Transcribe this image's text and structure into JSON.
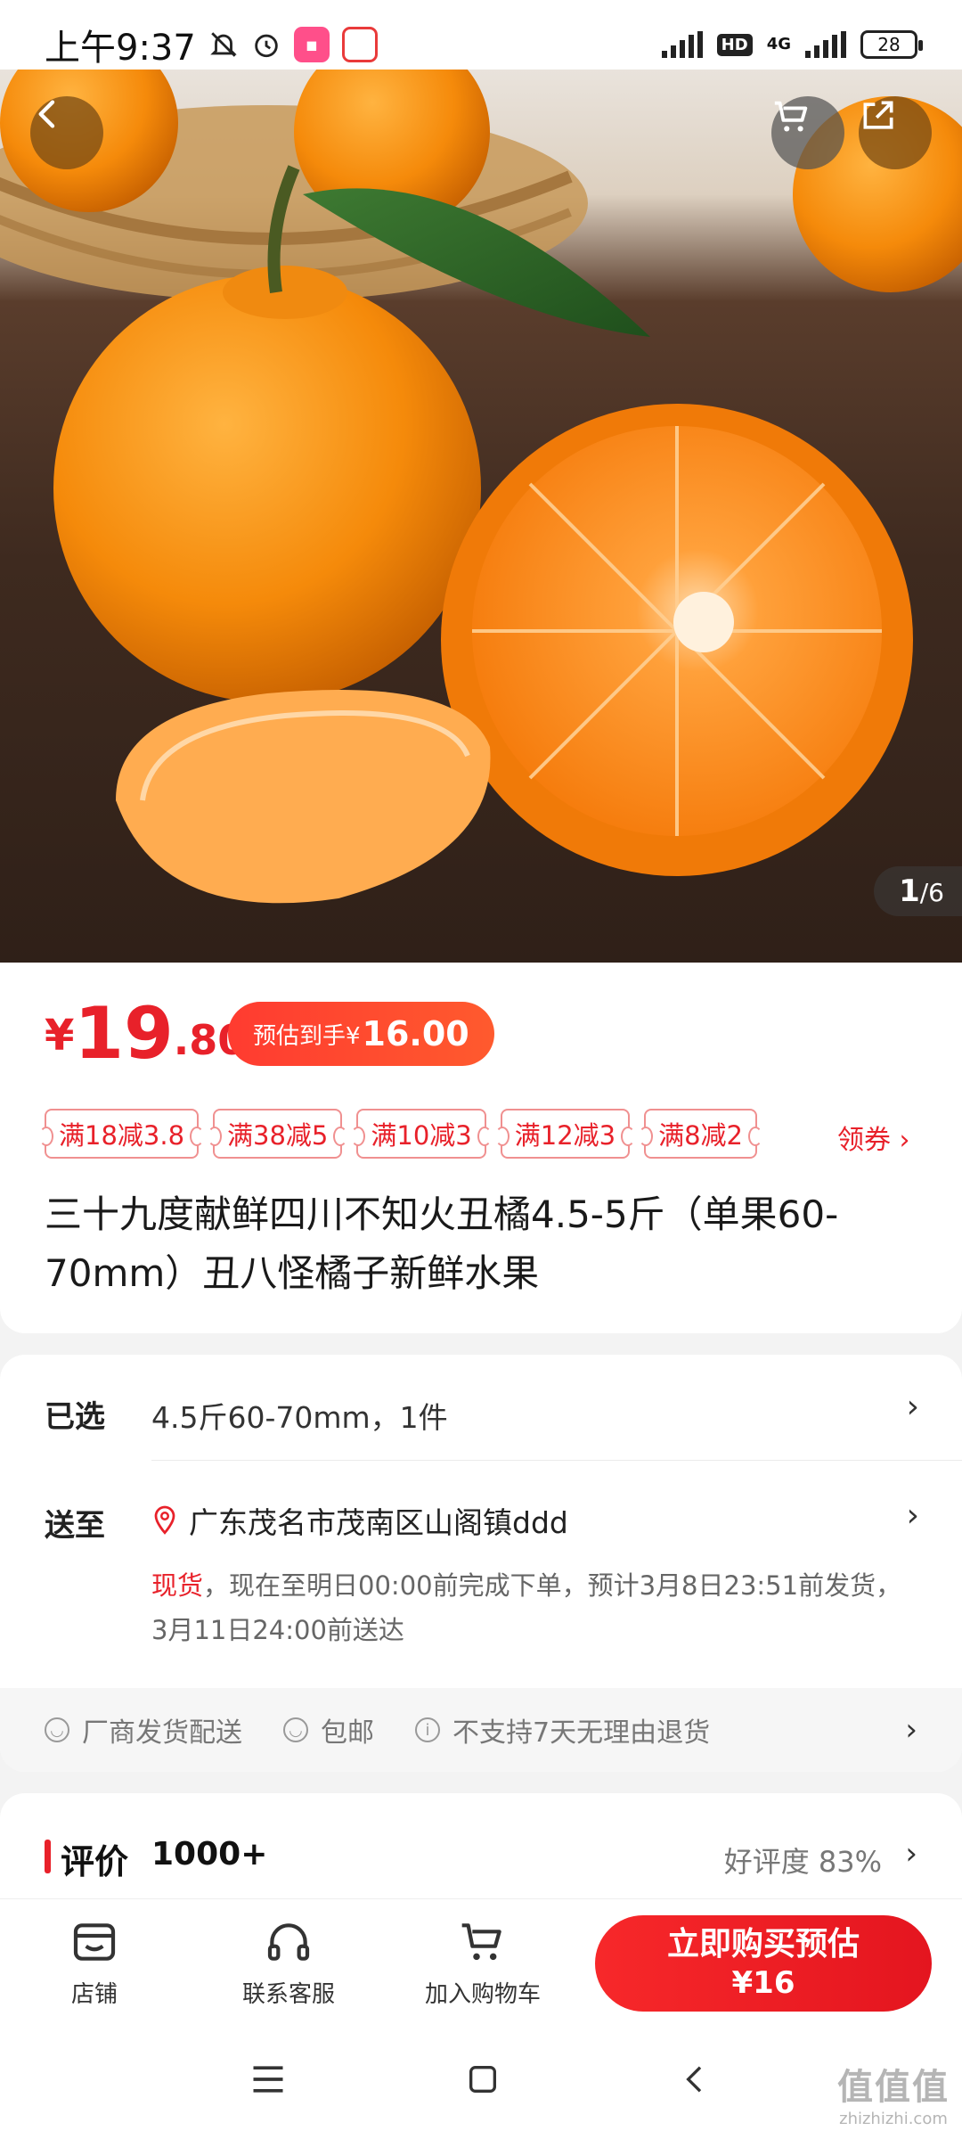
{
  "status_bar": {
    "time": "上午9:37",
    "hd": "HD",
    "network": "4G",
    "battery": "28"
  },
  "gallery": {
    "current": "1",
    "total": "/6"
  },
  "price": {
    "symbol": "¥",
    "integer": "19",
    "decimal": ".80",
    "estimate_label": "预估到手¥",
    "estimate_value": "16.00"
  },
  "coupons": [
    "满18减3.8",
    "满38减5",
    "满10减3",
    "满12减3",
    "满8减2"
  ],
  "get_coupon": "领券 ›",
  "product_title": "三十九度献鲜四川不知火丑橘4.5-5斤（单果60-70mm）丑八怪橘子新鲜水果",
  "selection": {
    "selected_label": "已选",
    "selected_value": "4.5斤60-70mm，1件",
    "ship_label": "送至",
    "address": "广东茂名市茂南区山阁镇ddd",
    "stock": "现货",
    "delivery_text": "，现在至明日00:00前完成下单，预计3月8日23:51前发货，3月11日24:00前送达"
  },
  "services": [
    "厂商发货配送",
    "包邮",
    "不支持7天无理由退货"
  ],
  "review": {
    "title": "评价",
    "count": "1000+",
    "rate": "好评度 83%"
  },
  "actions": {
    "store": "店铺",
    "service": "联系客服",
    "cart": "加入购物车",
    "buy_line1": "立即购买预估",
    "buy_line2": "¥16"
  },
  "watermark": {
    "main": "值值值",
    "sub": "zhizhizhi.com"
  },
  "colors": {
    "accent": "#e8212a",
    "button_gradient_start": "#f7282a"
  }
}
